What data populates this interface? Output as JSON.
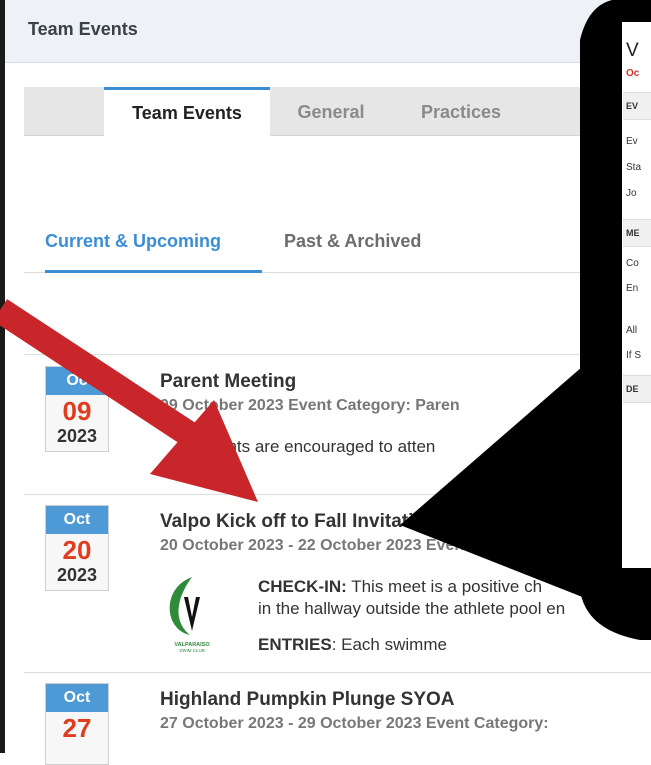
{
  "header": {
    "title": "Team Events"
  },
  "tabs": [
    {
      "label": "Team Events",
      "active": true
    },
    {
      "label": "General",
      "active": false
    },
    {
      "label": "Practices",
      "active": false
    }
  ],
  "subtabs": [
    {
      "label": "Current & Upcoming",
      "active": true
    },
    {
      "label": "Past & Archived",
      "active": false
    }
  ],
  "events": [
    {
      "month": "Oc",
      "day": "09",
      "year": "2023",
      "title": "Parent Meeting",
      "subtitle": "09 October 2023 Event Category: Paren",
      "body": "ents are encouraged to atten"
    },
    {
      "month": "Oct",
      "day": "20",
      "year": "2023",
      "title": "Valpo Kick off to Fall Invitational",
      "subtitle": "20 October 2023 - 22 October 2023 Event Ca",
      "body_line1_label": "CHECK-IN:",
      "body_line1_text": " This meet is a positive ch",
      "body_line2": "in the hallway outside the athlete pool en",
      "body_line3_label": "ENTRIES",
      "body_line3_text": ": Each swimme",
      "logo_text": "VALPARAISO SWIM CLUB"
    },
    {
      "month": "Oct",
      "day": "27",
      "year": "",
      "title": "Highland Pumpkin Plunge SYOA",
      "subtitle": "27 October 2023 - 29 October 2023 Event Category:"
    }
  ],
  "popover": {
    "title": "V",
    "date_fragment": "Oc",
    "section_event": "EV",
    "row1": "Ev",
    "row2": "Sta",
    "row3": "Jo",
    "section_meet": "ME",
    "row4": "Co",
    "row5": "En",
    "row6": "All",
    "row7": "If S",
    "section_desc": "DE"
  },
  "colors": {
    "accent_blue": "#3a8ed6",
    "date_red": "#e23c1f",
    "arrow_red": "#c8262a",
    "bubble_black": "#000000"
  }
}
